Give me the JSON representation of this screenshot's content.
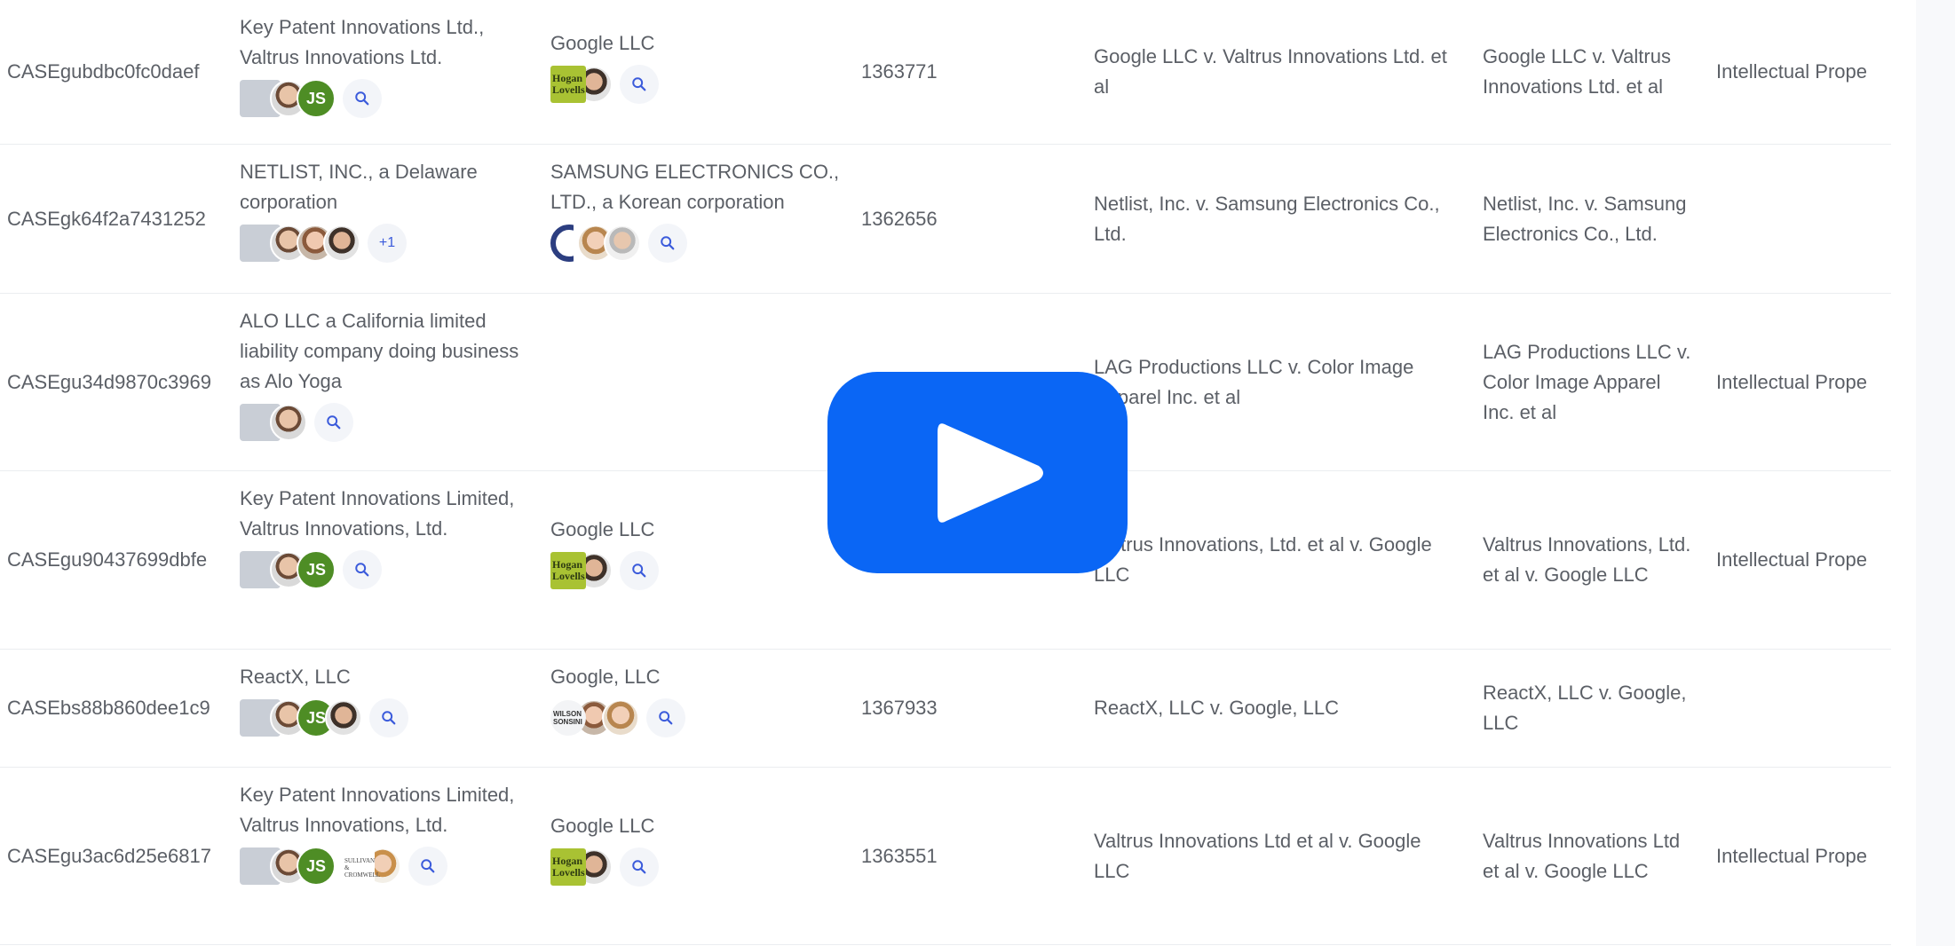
{
  "rows": [
    {
      "id": "CASEgubdbc0fc0daef",
      "plaintiff": "Key Patent Innovations Ltd., Valtrus Innovations Ltd.",
      "defendant": "Google LLC",
      "number": "1363771",
      "case_name": "Google LLC v. Valtrus Innovations Ltd. et al",
      "short_name": "Google LLC v. Valtrus Innovations Ltd. et al",
      "type": "Intellectual Prope"
    },
    {
      "id": "CASEgk64f2a7431252",
      "plaintiff": "NETLIST, INC., a Delaware corporation",
      "defendant": "SAMSUNG ELECTRONICS CO., LTD., a Korean corporation",
      "number": "1362656",
      "case_name": "Netlist, Inc. v. Samsung Electronics Co., Ltd.",
      "short_name": "Netlist, Inc. v. Samsung Electronics Co., Ltd.",
      "type": "",
      "plus_count": "+1"
    },
    {
      "id": "CASEgu34d9870c3969",
      "plaintiff": "ALO LLC a California limited liability company doing business as Alo Yoga",
      "defendant": "",
      "number": "",
      "case_name": "LAG Productions LLC v. Color Image Apparel Inc. et al",
      "short_name": "LAG Productions LLC v. Color Image Apparel Inc. et al",
      "type": "Intellectual Prope"
    },
    {
      "id": "CASEgu90437699dbfe",
      "plaintiff": "Key Patent Innovations Limited, Valtrus Innovations, Ltd.",
      "defendant": "Google LLC",
      "number": "",
      "case_name": "Valtrus Innovations, Ltd. et al v. Google LLC",
      "short_name": "Valtrus Innovations, Ltd. et al v. Google LLC",
      "type": "Intellectual Prope"
    },
    {
      "id": "CASEbs88b860dee1c9",
      "plaintiff": "ReactX, LLC",
      "defendant": "Google, LLC",
      "number": "1367933",
      "case_name": "ReactX, LLC v. Google, LLC",
      "short_name": "ReactX, LLC v. Google, LLC",
      "type": ""
    },
    {
      "id": "CASEgu3ac6d25e6817",
      "plaintiff": "Key Patent Innovations Limited, Valtrus Innovations, Ltd.",
      "defendant": "Google LLC",
      "number": "1363551",
      "case_name": "Valtrus Innovations Ltd et al v. Google LLC",
      "short_name": "Valtrus Innovations Ltd et al v. Google LLC",
      "type": "Intellectual Prope"
    }
  ],
  "avatars": {
    "initials": "JS",
    "hogan_logo": "Hogan Lovells",
    "wilson_logo": "WILSON SONSINI",
    "sullivan_logo": "SULLIVAN & CROMWELL"
  },
  "icons": {
    "search": "search-icon",
    "play": "play-icon"
  },
  "colors": {
    "play_button": "#0a66f5",
    "initials_bg": "#4e8d25",
    "search_icon": "#3b5bdb"
  }
}
